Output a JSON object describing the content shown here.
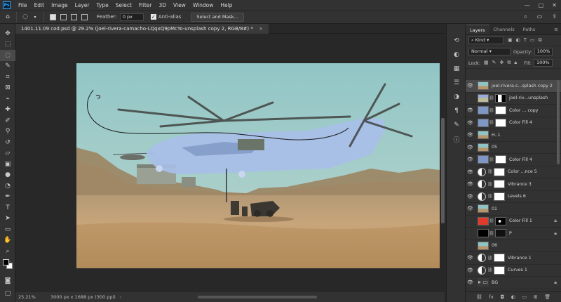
{
  "app": {
    "logo": "Ps",
    "menu": [
      "File",
      "Edit",
      "Image",
      "Layer",
      "Type",
      "Select",
      "Filter",
      "3D",
      "View",
      "Window",
      "Help"
    ]
  },
  "options": {
    "feather_label": "Feather:",
    "feather_value": "0 px",
    "antialias_label": "Anti-alias",
    "select_mask": "Select and Mask..."
  },
  "document": {
    "tab_title": "1401.11.09 cod.psd @ 29.2% (joel-rivera-camacho-LQqxQ9pMcYo-unsplash copy 2, RGB/8#) *",
    "close": "×"
  },
  "status": {
    "zoom": "25.21%",
    "info": "3000 px x 1688 px (300 ppi)"
  },
  "panel": {
    "tabs": [
      "Layers",
      "Channels",
      "Paths"
    ],
    "filter_kind": "Kind",
    "blend_mode": "Normal",
    "opacity_label": "Opacity:",
    "opacity_value": "100%",
    "lock_label": "Lock:",
    "fill_label": "Fill:",
    "fill_value": "100%"
  },
  "layers": [
    {
      "name": "joel-rivera-c...splash copy 2",
      "visible": true,
      "selected": true,
      "type": "photo",
      "mask": "none"
    },
    {
      "name": "joel-riv...unsplash",
      "visible": false,
      "selected": false,
      "type": "photo2",
      "mask": "strip"
    },
    {
      "name": "Color ... copy",
      "visible": true,
      "selected": false,
      "type": "fill-blue",
      "mask": "white"
    },
    {
      "name": "Color Fill 4",
      "visible": true,
      "selected": false,
      "type": "fill-blue",
      "mask": "white"
    },
    {
      "name": "H..1",
      "visible": true,
      "selected": false,
      "type": "photo",
      "mask": "none"
    },
    {
      "name": "05",
      "visible": true,
      "selected": false,
      "type": "photo",
      "mask": "none"
    },
    {
      "name": "Color Fill 4",
      "visible": true,
      "selected": false,
      "type": "fill-blue",
      "mask": "white"
    },
    {
      "name": "Color ...nce 5",
      "visible": true,
      "selected": false,
      "type": "adj",
      "mask": "white"
    },
    {
      "name": "Vibrance 3",
      "visible": true,
      "selected": false,
      "type": "adj",
      "mask": "white"
    },
    {
      "name": "Levels 6",
      "visible": true,
      "selected": false,
      "type": "adj",
      "mask": "white"
    },
    {
      "name": "01",
      "visible": true,
      "selected": false,
      "type": "photo",
      "mask": "none"
    },
    {
      "name": "Color Fill 1",
      "visible": false,
      "selected": false,
      "type": "fill-red",
      "mask": "splat"
    },
    {
      "name": "P",
      "visible": false,
      "selected": false,
      "type": "fill-black",
      "mask": "black"
    },
    {
      "name": "06",
      "visible": false,
      "selected": false,
      "type": "photo",
      "mask": "none"
    },
    {
      "name": "Vibrance 1",
      "visible": true,
      "selected": false,
      "type": "adj",
      "mask": "white"
    },
    {
      "name": "Curves 1",
      "visible": true,
      "selected": false,
      "type": "adj",
      "mask": "white"
    },
    {
      "name": "BG",
      "visible": true,
      "selected": false,
      "type": "folder",
      "mask": "none"
    }
  ],
  "colors": {
    "accent": "#31a8ff",
    "selection_overlay": "#a8bfe8",
    "sky": "#8fc3c4"
  }
}
